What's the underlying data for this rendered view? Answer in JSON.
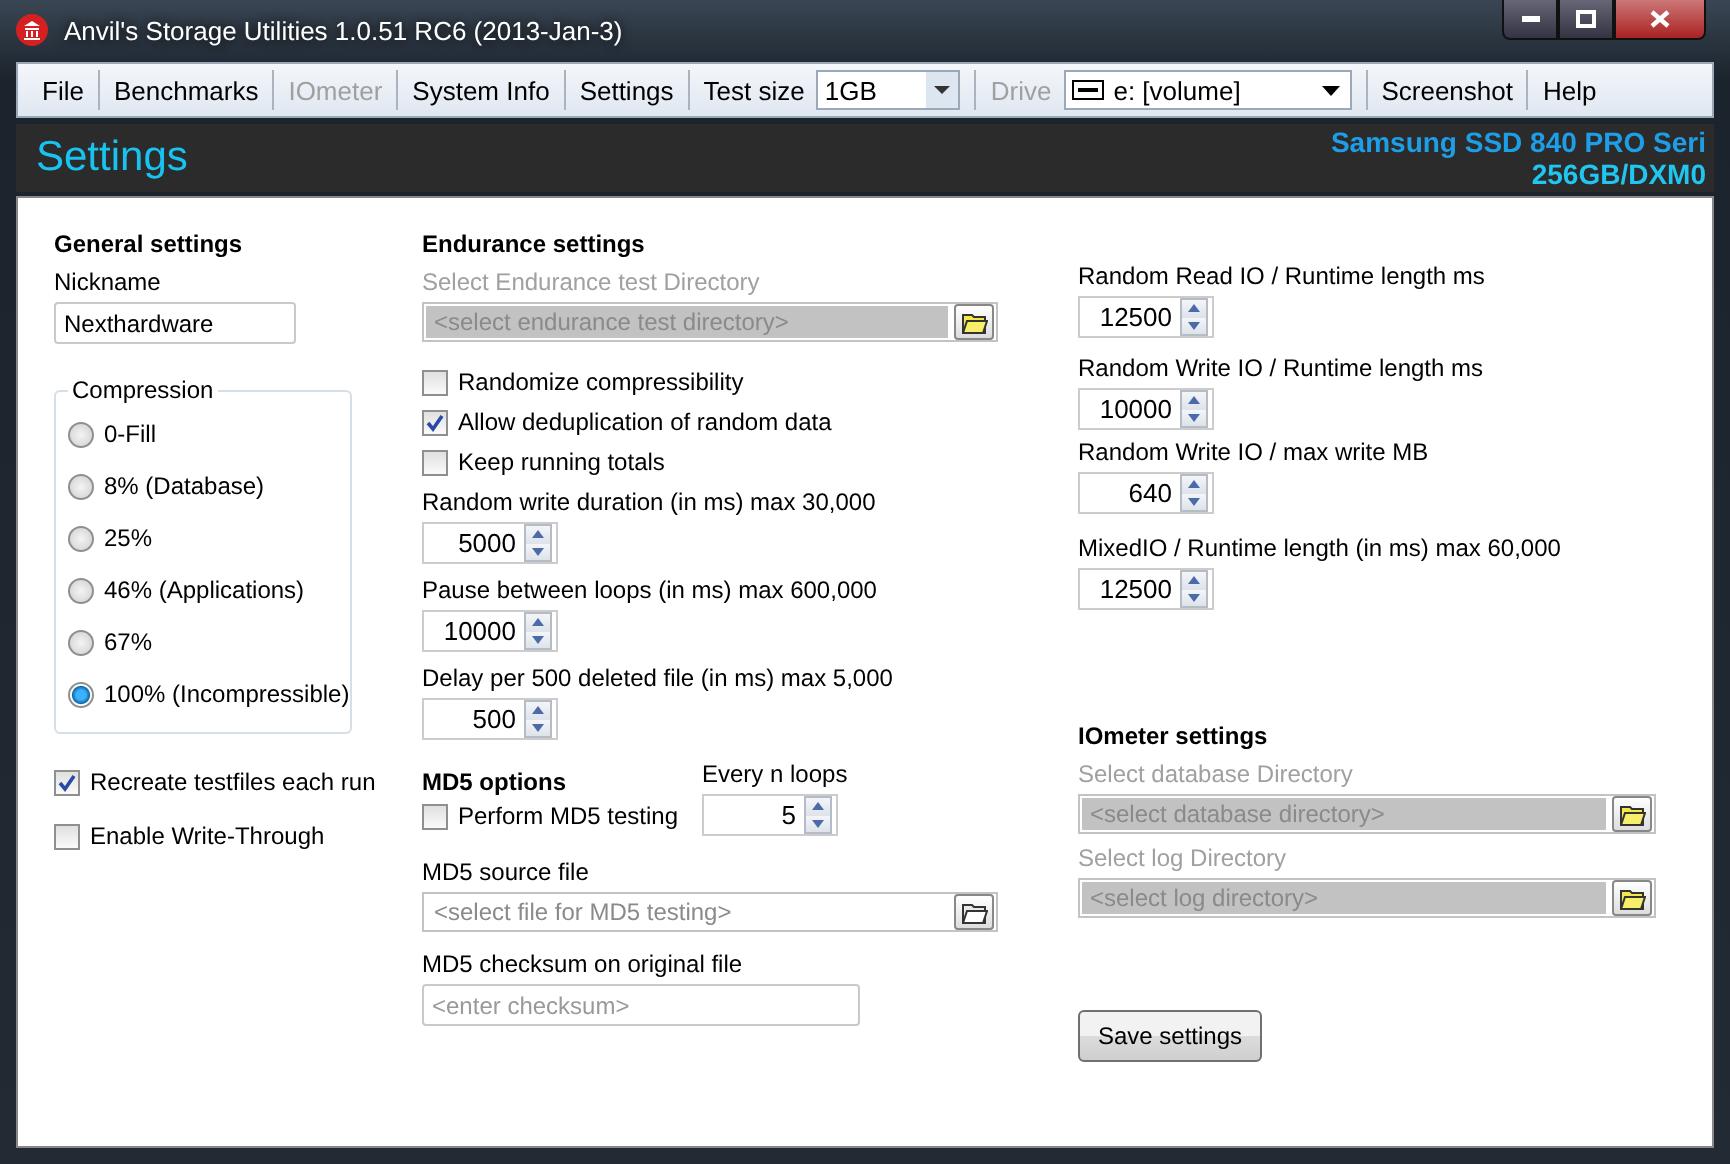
{
  "window": {
    "title": "Anvil's Storage Utilities 1.0.51 RC6 (2013-Jan-3)"
  },
  "toolbar": [
    {
      "kind": "menu",
      "label": "File",
      "disabled": false
    },
    {
      "kind": "menu",
      "label": "Benchmarks",
      "disabled": false
    },
    {
      "kind": "menu",
      "label": "IOmeter",
      "disabled": true
    },
    {
      "kind": "menu",
      "label": "System Info",
      "disabled": false
    },
    {
      "kind": "menu",
      "label": "Settings",
      "disabled": false
    },
    {
      "kind": "combo",
      "label": "Test size",
      "value": "1GB"
    },
    {
      "kind": "drive",
      "label": "Drive",
      "value": "e: [volume]",
      "disabled": true
    },
    {
      "kind": "menu",
      "label": "Screenshot",
      "disabled": false
    },
    {
      "kind": "menu",
      "label": "Help",
      "disabled": false
    }
  ],
  "header": {
    "title": "Settings",
    "device": [
      "Samsung SSD 840 PRO Seri",
      "256GB/DXM0"
    ]
  },
  "general": {
    "heading": "General settings",
    "nickname": {
      "label": "Nickname",
      "value": "Nexthardware"
    },
    "compression": {
      "legend": "Compression",
      "options": [
        {
          "label": "0-Fill",
          "selected": false
        },
        {
          "label": "8% (Database)",
          "selected": false
        },
        {
          "label": "25%",
          "selected": false
        },
        {
          "label": "46% (Applications)",
          "selected": false
        },
        {
          "label": "67%",
          "selected": false
        },
        {
          "label": "100% (Incompressible)",
          "selected": true
        }
      ]
    },
    "checkboxes": [
      {
        "label": "Recreate testfiles each run",
        "checked": true
      },
      {
        "label": "Enable Write-Through",
        "checked": false
      }
    ]
  },
  "endurance": {
    "heading": "Endurance settings",
    "directory": {
      "label": "Select Endurance test Directory",
      "placeholder": "<select endurance test directory>"
    },
    "checkboxes": [
      {
        "label": "Randomize compressibility",
        "checked": false
      },
      {
        "label": "Allow deduplication of random data",
        "checked": true
      },
      {
        "label": "Keep running totals",
        "checked": false
      }
    ],
    "spinners": [
      {
        "label": "Random write duration (in ms) max 30,000",
        "value": "5000"
      },
      {
        "label": "Pause between loops (in ms) max 600,000",
        "value": "10000"
      },
      {
        "label": "Delay per 500 deleted file (in ms) max 5,000",
        "value": "500"
      }
    ]
  },
  "md5": {
    "heading": "MD5 options",
    "perform": {
      "label": "Perform MD5 testing",
      "checked": false
    },
    "every": {
      "label": "Every n loops",
      "value": "5"
    },
    "source": {
      "label": "MD5 source file",
      "placeholder": "<select file for MD5 testing>"
    },
    "checksum": {
      "label": "MD5 checksum on original file",
      "placeholder": "<enter checksum>"
    }
  },
  "runtime": [
    {
      "label": "Random Read IO / Runtime length ms",
      "value": "12500"
    },
    {
      "label": "Random Write IO / Runtime length ms",
      "value": "10000"
    },
    {
      "label": "Random Write IO / max write MB",
      "value": "640"
    },
    {
      "label": "MixedIO / Runtime length (in ms) max 60,000",
      "value": "12500"
    }
  ],
  "iometer": {
    "heading": "IOmeter settings",
    "directories": [
      {
        "label": "Select database Directory",
        "placeholder": "<select database directory>"
      },
      {
        "label": "Select log Directory",
        "placeholder": "<select log directory>"
      }
    ]
  },
  "save_button": "Save settings"
}
